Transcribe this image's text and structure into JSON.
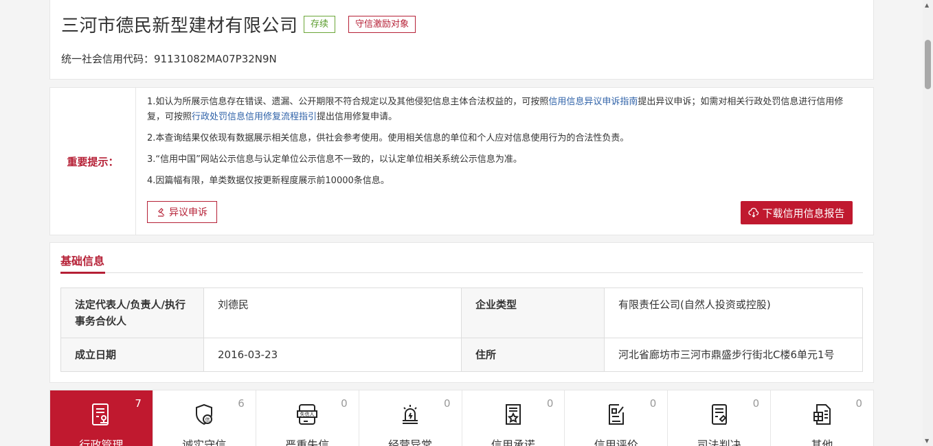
{
  "company": {
    "name": "三河市德民新型建材有限公司",
    "status_badge": "存续",
    "honor_badge": "守信激励对象",
    "credit_code_label": "统一社会信用代码：",
    "credit_code": "91131082MA07P32N9N"
  },
  "notice": {
    "label": "重要提示：",
    "p1_a": "1.如认为所展示信息存在错误、遗漏、公开期限不符合规定以及其他侵犯信息主体合法权益的，可按照",
    "p1_link1": "信用信息异议申诉指南",
    "p1_b": "提出异议申诉；如需对相关行政处罚信息进行信用修复，可按照",
    "p1_link2": "行政处罚信息信用修复流程指引",
    "p1_c": "提出信用修复申请。",
    "p2": "2.本查询结果仅依现有数据展示相关信息，供社会参考使用。使用相关信息的单位和个人应对信息使用行为的合法性负责。",
    "p3": "3.“信用中国”网站公示信息与认定单位公示信息不一致的，以认定单位相关系统公示信息为准。",
    "p4": "4.因篇幅有限，单类数据仅按更新程度展示前10000条信息。",
    "objection_button": "异议申诉",
    "download_button": "下载信用信息报告"
  },
  "basic": {
    "section_title": "基础信息",
    "rows": [
      {
        "k1": "法定代表人/负责人/执行事务合伙人",
        "v1": "刘德民",
        "k2": "企业类型",
        "v2": "有限责任公司(自然人投资或控股)"
      },
      {
        "k1": "成立日期",
        "v1": "2016-03-23",
        "k2": "住所",
        "v2": "河北省廊坊市三河市鼎盛步行街北C楼6单元1号"
      }
    ]
  },
  "tabs": [
    {
      "label": "行政管理",
      "count": "7",
      "icon": "admin-doc-icon"
    },
    {
      "label": "诚实守信",
      "count": "6",
      "icon": "shield-xin-icon"
    },
    {
      "label": "严重失信",
      "count": "0",
      "icon": "dishonest-person-icon",
      "icon_text": "失信人"
    },
    {
      "label": "经营异常",
      "count": "0",
      "icon": "alarm-light-icon"
    },
    {
      "label": "信用承诺",
      "count": "0",
      "icon": "star-doc-icon"
    },
    {
      "label": "信用评价",
      "count": "0",
      "icon": "evaluation-doc-icon"
    },
    {
      "label": "司法判决",
      "count": "0",
      "icon": "gavel-doc-icon"
    },
    {
      "label": "其他",
      "count": "0",
      "icon": "grid-doc-icon"
    }
  ],
  "colors": {
    "accent": "#c0192f",
    "link": "#2f62a8",
    "green": "#6aa536"
  }
}
